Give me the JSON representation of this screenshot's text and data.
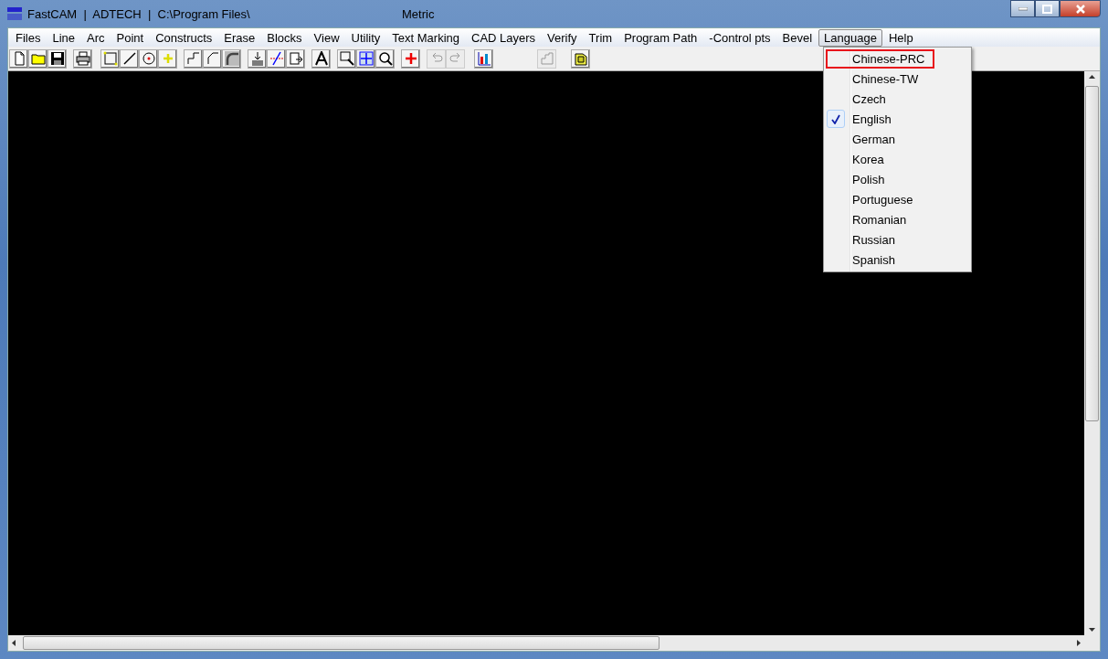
{
  "window": {
    "title": "FastCAM  |  ADTECH  |  C:\\Program Files\\",
    "units": "Metric"
  },
  "menu": [
    {
      "label": "Files",
      "selected": false
    },
    {
      "label": "Line",
      "selected": false
    },
    {
      "label": "Arc",
      "selected": false
    },
    {
      "label": "Point",
      "selected": false
    },
    {
      "label": "Constructs",
      "selected": false
    },
    {
      "label": "Erase",
      "selected": false
    },
    {
      "label": "Blocks",
      "selected": false
    },
    {
      "label": "View",
      "selected": false
    },
    {
      "label": "Utility",
      "selected": false
    },
    {
      "label": "Text Marking",
      "selected": false
    },
    {
      "label": "CAD Layers",
      "selected": false
    },
    {
      "label": "Verify",
      "selected": false
    },
    {
      "label": "Trim",
      "selected": false
    },
    {
      "label": "Program Path",
      "selected": false
    },
    {
      "label": "-Control pts",
      "selected": false
    },
    {
      "label": "Bevel",
      "selected": false
    },
    {
      "label": "Language",
      "selected": true
    },
    {
      "label": "Help",
      "selected": false
    }
  ],
  "toolbar": [
    [
      {
        "disabled": false
      },
      {
        "disabled": false
      },
      {
        "disabled": false
      }
    ],
    [
      {
        "disabled": false
      }
    ],
    [
      {
        "disabled": false
      },
      {
        "disabled": false
      },
      {
        "disabled": false
      },
      {
        "disabled": false
      }
    ],
    [
      {
        "disabled": false
      },
      {
        "disabled": false
      },
      {
        "disabled": false
      }
    ],
    [
      {
        "disabled": false
      },
      {
        "disabled": false
      },
      {
        "disabled": false
      }
    ],
    [
      {
        "disabled": false
      }
    ],
    [
      {
        "disabled": false
      },
      {
        "disabled": false
      },
      {
        "disabled": false
      }
    ],
    [
      {
        "disabled": false
      }
    ],
    [
      {
        "disabled": true
      },
      {
        "disabled": true
      }
    ],
    [
      {
        "disabled": false
      }
    ],
    [
      {
        "disabled": true
      }
    ],
    [
      {
        "disabled": false
      }
    ]
  ],
  "language_menu": [
    {
      "label": "Chinese-PRC",
      "checked": false,
      "highlighted": true
    },
    {
      "label": "Chinese-TW",
      "checked": false,
      "highlighted": false
    },
    {
      "label": "Czech",
      "checked": false,
      "highlighted": false
    },
    {
      "label": "English",
      "checked": true,
      "highlighted": false
    },
    {
      "label": "German",
      "checked": false,
      "highlighted": false
    },
    {
      "label": "Korea",
      "checked": false,
      "highlighted": false
    },
    {
      "label": "Polish",
      "checked": false,
      "highlighted": false
    },
    {
      "label": "Portuguese",
      "checked": false,
      "highlighted": false
    },
    {
      "label": "Romanian",
      "checked": false,
      "highlighted": false
    },
    {
      "label": "Russian",
      "checked": false,
      "highlighted": false
    },
    {
      "label": "Spanish",
      "checked": false,
      "highlighted": false
    }
  ]
}
